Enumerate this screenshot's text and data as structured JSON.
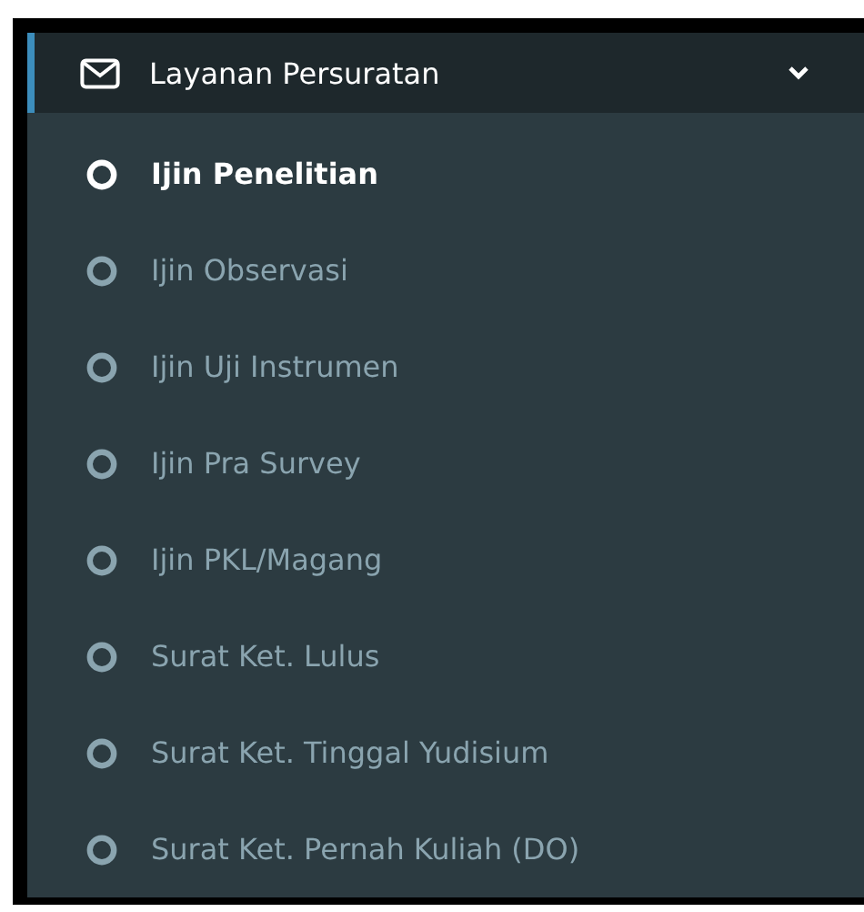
{
  "menu": {
    "label": "Layanan Persuratan",
    "expanded": true,
    "items": [
      {
        "label": "Ijin Penelitian",
        "selected": true
      },
      {
        "label": "Ijin Observasi",
        "selected": false
      },
      {
        "label": "Ijin Uji Instrumen",
        "selected": false
      },
      {
        "label": "Ijin Pra Survey",
        "selected": false
      },
      {
        "label": "Ijin PKL/Magang",
        "selected": false
      },
      {
        "label": "Surat Ket. Lulus",
        "selected": false
      },
      {
        "label": "Surat Ket. Tinggal Yudisium",
        "selected": false
      },
      {
        "label": "Surat Ket. Pernah Kuliah (DO)",
        "selected": false
      }
    ]
  }
}
